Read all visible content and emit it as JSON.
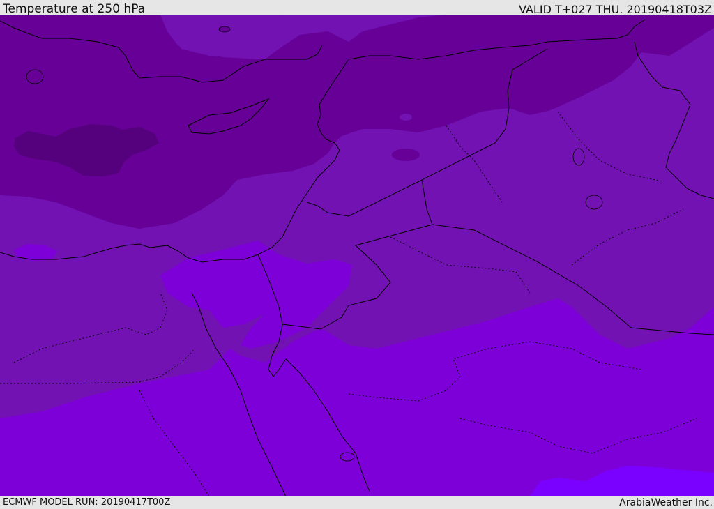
{
  "header": {
    "title": "Temperature at 250 hPa",
    "valid": "VALID T+027 THU. 20190418T03Z"
  },
  "footer": {
    "model_run": "ECMWF MODEL RUN: 20190417T00Z",
    "credit": "ArabiaWeather Inc."
  },
  "colors": {
    "coldest": "#55007d",
    "cold": "#660096",
    "cool": "#7212b3",
    "mild": "#7e00d9",
    "warm": "#7a00ff",
    "border": "#000000"
  }
}
